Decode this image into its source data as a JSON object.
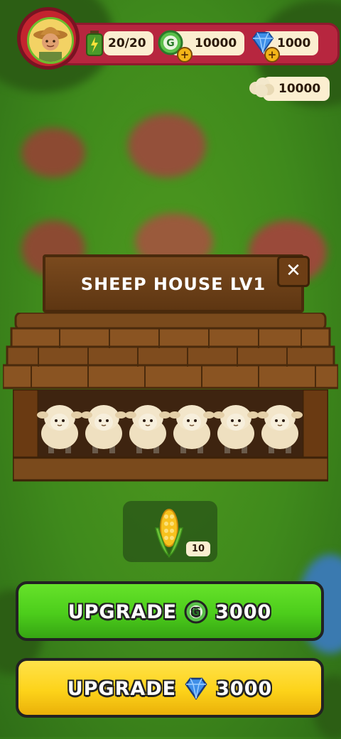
{
  "hud": {
    "energy": "20/20",
    "coins": "10000",
    "gems": "1000",
    "wool": "10000"
  },
  "panel": {
    "title": "SHEEP HOUSE LV1",
    "close_label": "✕",
    "sheep_count": 6
  },
  "resource": {
    "icon": "corn-icon",
    "count": "10"
  },
  "buttons": {
    "upgrade_coins": {
      "label": "UPGRADE",
      "price": "3000",
      "icon": "coin-icon",
      "color": "#4ccd1b"
    },
    "upgrade_gems": {
      "label": "UPGRADE",
      "price": "3000",
      "icon": "gem-icon",
      "color": "#fdd31a"
    }
  }
}
